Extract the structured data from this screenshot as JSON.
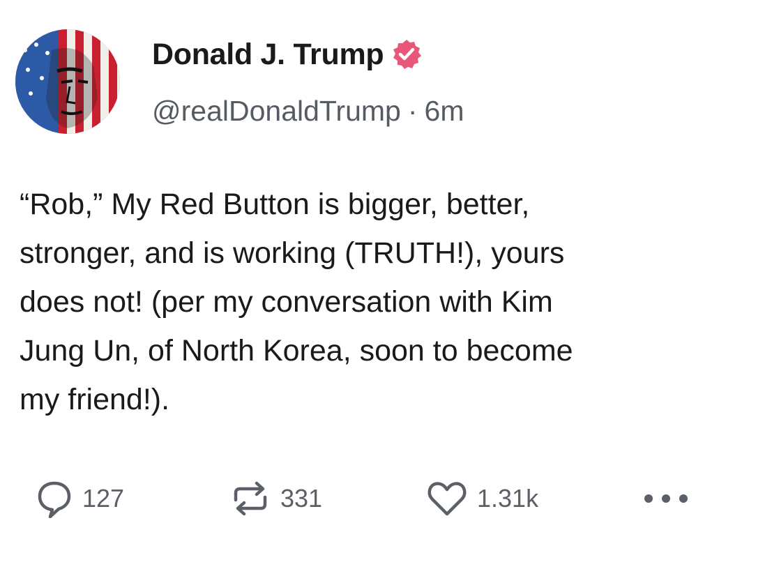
{
  "author": {
    "display_name": "Donald J. Trump",
    "handle": "@realDonaldTrump",
    "separator": "·",
    "time_ago": "6m",
    "verified_color": "#e8567a"
  },
  "post": {
    "text": "“Rob,” My Red Button is bigger, better,\nstronger, and is working (TRUTH!), yours\ndoes not! (per my conversation with Kim\nJung Un, of North Korea, soon to become\nmy friend!)."
  },
  "actions": {
    "replies": "127",
    "retruths": "331",
    "likes": "1.31k",
    "reply_icon": "speech-bubble-icon",
    "retruth_icon": "repost-arrows-icon",
    "like_icon": "heart-icon",
    "more_icon": "ellipsis-icon"
  }
}
